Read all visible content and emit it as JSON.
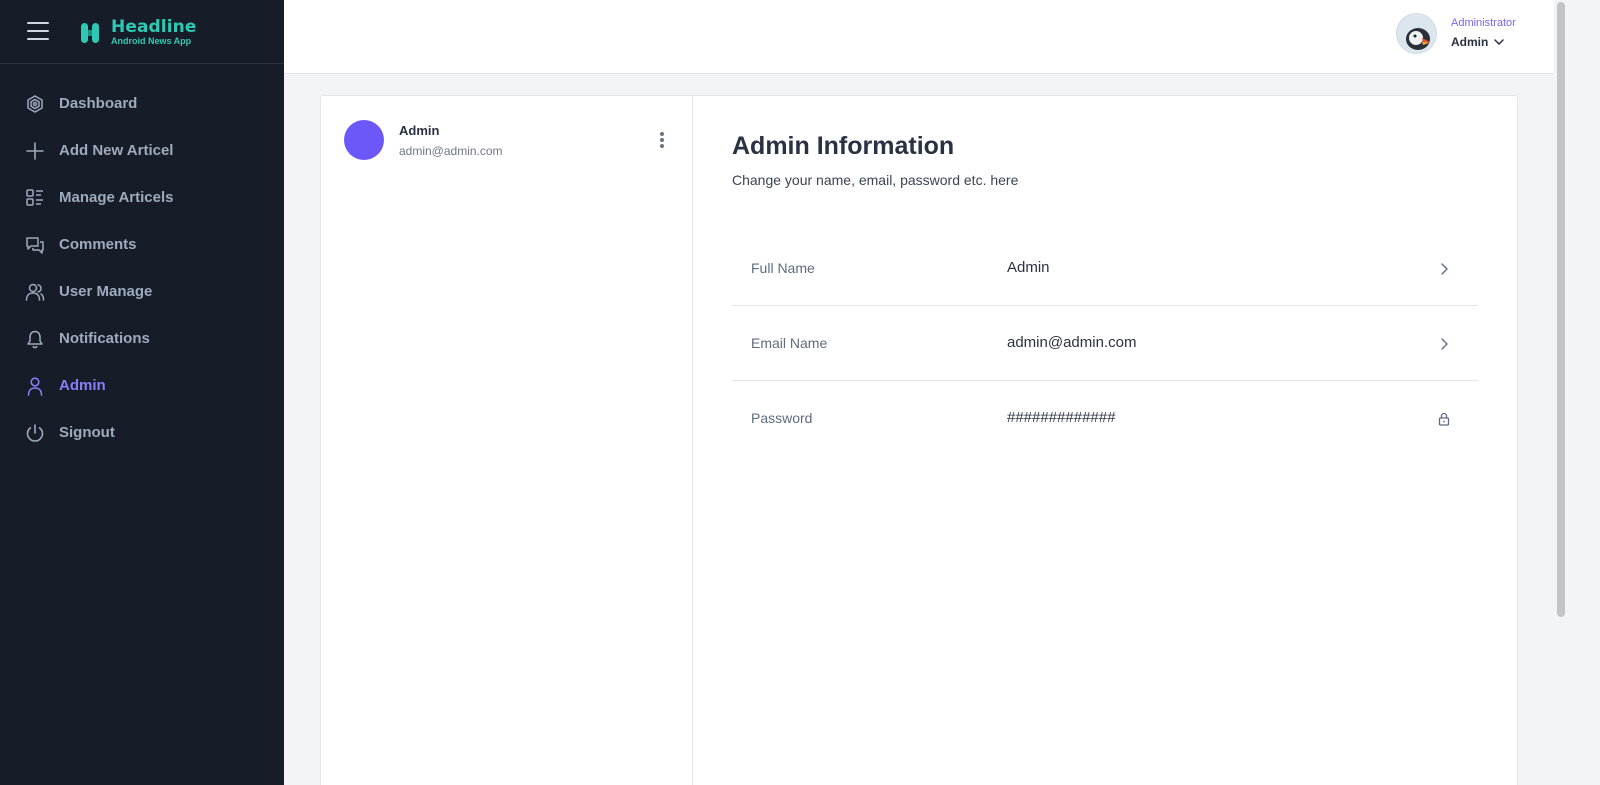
{
  "app": {
    "title": "Headline",
    "subtitle": "Android News App"
  },
  "nav": {
    "items": [
      {
        "label": "Dashboard",
        "icon": "dashboard-icon",
        "active": false
      },
      {
        "label": "Add New Articel",
        "icon": "plus-icon",
        "active": false
      },
      {
        "label": "Manage Articels",
        "icon": "grid-list-icon",
        "active": false
      },
      {
        "label": "Comments",
        "icon": "comments-icon",
        "active": false
      },
      {
        "label": "User Manage",
        "icon": "users-icon",
        "active": false
      },
      {
        "label": "Notifications",
        "icon": "bell-icon",
        "active": false
      },
      {
        "label": "Admin",
        "icon": "user-icon",
        "active": true
      },
      {
        "label": "Signout",
        "icon": "power-icon",
        "active": false
      }
    ]
  },
  "topbar": {
    "role": "Administrator",
    "name": "Admin"
  },
  "profile": {
    "name": "Admin",
    "email": "admin@admin.com"
  },
  "info": {
    "title": "Admin Information",
    "subtitle": "Change your name, email, password etc. here",
    "rows": [
      {
        "label": "Full Name",
        "value": "Admin",
        "icon": "chevron-right-icon"
      },
      {
        "label": "Email Name",
        "value": "admin@admin.com",
        "icon": "chevron-right-icon"
      },
      {
        "label": "Password",
        "value": "#############",
        "icon": "lock-icon"
      }
    ]
  },
  "colors": {
    "sidebar_bg": "#161d29",
    "brand": "#2fc8b4",
    "accent": "#7b63f3",
    "avatar": "#6c57f8"
  }
}
